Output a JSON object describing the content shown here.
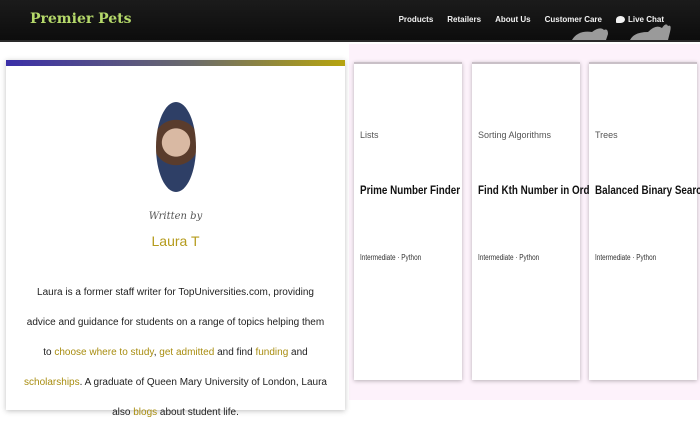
{
  "brand": {
    "name": "Premier Pets"
  },
  "nav": {
    "items": [
      "Products",
      "Retailers",
      "About Us",
      "Customer Care"
    ],
    "chat_label": "Live Chat"
  },
  "author": {
    "written_by": "Written by",
    "name": "Laura T",
    "bio": {
      "p1": "Laura is a former staff writer for TopUniversities.com, providing advice and guidance for students on a range of topics helping them to ",
      "link1": "choose where to study",
      "p2": ", ",
      "link2": "get admitted",
      "p3": " and find ",
      "link3": "funding",
      "p4": " and ",
      "link4": "scholarships",
      "p5": ". A graduate of Queen Mary University of London, Laura also ",
      "link5": "blogs",
      "p6": " about student life."
    }
  },
  "courses": [
    {
      "category": "Lists",
      "title": "Prime Number Finder",
      "meta": "Intermediate · Python"
    },
    {
      "category": "Sorting Algorithms",
      "title": "Find Kth Number in Order",
      "meta": "Intermediate · Python"
    },
    {
      "category": "Trees",
      "title": "Balanced Binary Search Tree",
      "meta": "Intermediate · Python"
    }
  ],
  "colors": {
    "accent": "#b59b1c",
    "nav_bg": "#111111",
    "logo": "#b5d96a"
  }
}
